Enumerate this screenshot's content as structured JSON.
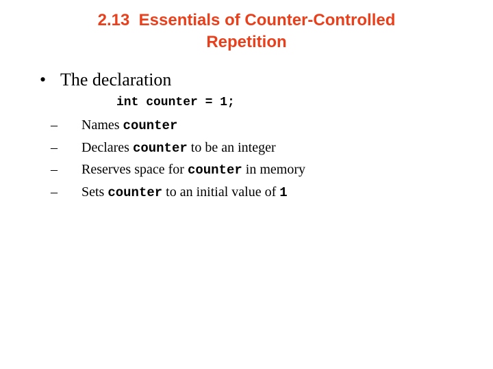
{
  "slide": {
    "title_lines": [
      "2.13  Essentials of Counter-Controlled",
      "Repetition"
    ],
    "title_color": "#e8401c",
    "bullet": {
      "marker": "•",
      "text": "The declaration"
    },
    "code": "int counter = 1;",
    "sub_marker": "–",
    "sub_items": [
      {
        "before": "Names ",
        "code": "counter",
        "after": ""
      },
      {
        "before": "Declares ",
        "code": "counter",
        "after": " to be an integer"
      },
      {
        "before": "Reserves space for ",
        "code": "counter",
        "after": " in memory"
      },
      {
        "before": "Sets ",
        "code": "counter",
        "after": " to an initial value of ",
        "code2": "1"
      }
    ]
  }
}
